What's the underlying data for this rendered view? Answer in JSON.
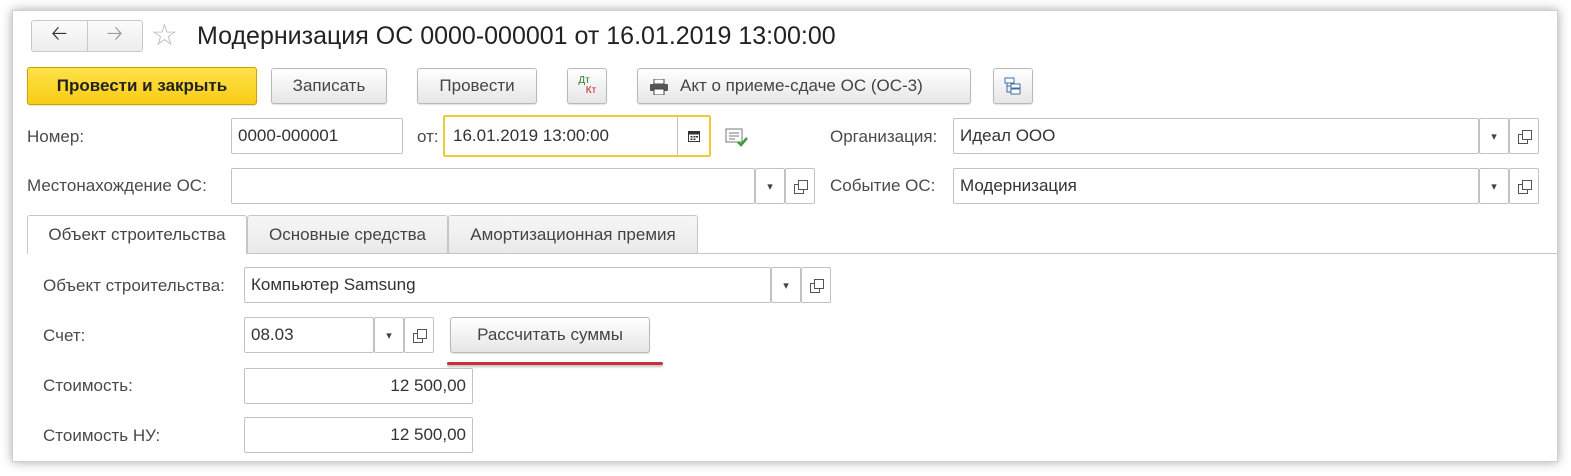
{
  "window": {
    "title": "Модернизация ОС 0000-000001 от 16.01.2019 13:00:00"
  },
  "nav": {
    "back_icon": "arrow-left-icon",
    "forward_icon": "arrow-right-icon",
    "favorite_icon": "star-icon"
  },
  "toolbar": {
    "post_and_close": "Провести и закрыть",
    "save": "Записать",
    "post": "Провести",
    "dt_kt_top": "Дт",
    "dt_kt_bottom": "Кт",
    "print_act": "Акт о приеме-сдаче ОС (ОС-3)",
    "structure_icon": "document-structure-icon"
  },
  "header": {
    "number_label": "Номер:",
    "number_value": "0000-000001",
    "date_label": "от:",
    "date_value": "16.01.2019 13:00:00",
    "org_label": "Организация:",
    "org_value": "Идеал ООО",
    "location_label": "Местонахождение ОС:",
    "location_value": "",
    "event_label": "Событие ОС:",
    "event_value": "Модернизация"
  },
  "tabs": [
    {
      "label": "Объект строительства",
      "active": true
    },
    {
      "label": "Основные средства",
      "active": false
    },
    {
      "label": "Амортизационная премия",
      "active": false
    }
  ],
  "form": {
    "object_label": "Объект строительства:",
    "object_value": "Компьютер Samsung",
    "account_label": "Счет:",
    "account_value": "08.03",
    "calc_button": "Рассчитать суммы",
    "cost_label": "Стоимость:",
    "cost_value": "12 500,00",
    "cost_nu_label": "Стоимость НУ:",
    "cost_nu_value": "12 500,00"
  },
  "colors": {
    "primary_button": "#f7cc14",
    "date_focus_border": "#f0c935",
    "annotation_underline": "#c8303a"
  }
}
